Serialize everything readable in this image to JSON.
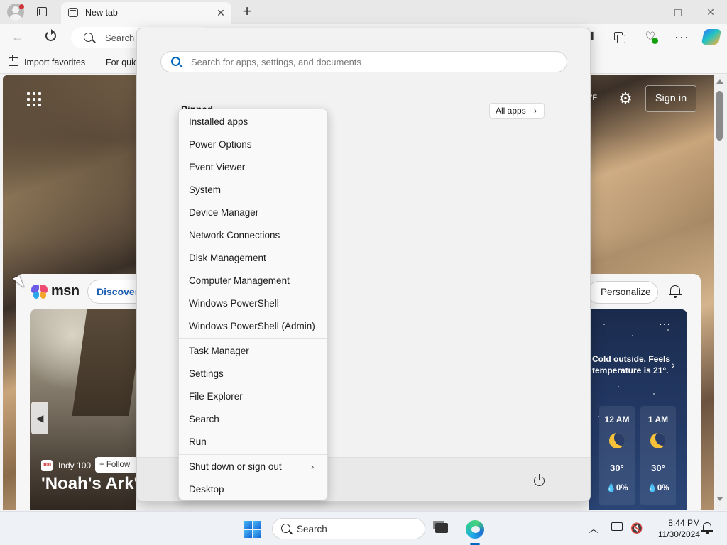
{
  "browser": {
    "tab_title": "New tab",
    "tab_close_glyph": "✕",
    "new_tab_glyph": "+",
    "back_glyph": "←",
    "address_placeholder": "Search",
    "favorites": {
      "import_label": "Import favorites",
      "quick_label": "For quic"
    },
    "more_glyph": "···",
    "icons": [
      "profile-icon",
      "tab-actions-icon",
      "refresh-icon",
      "split-screen-icon",
      "collections-icon",
      "browser-essentials-icon",
      "copilot-icon"
    ]
  },
  "msn": {
    "temp_unit": "°F",
    "gear_glyph": "⚙",
    "signin_label": "Sign in",
    "logo_text": "msn",
    "discover_label": "Discover",
    "personalize_label": "Personalize",
    "news": {
      "source_badge": "100",
      "source": "Indy 100",
      "follow_label": "+ Follow",
      "title": "'Noah's Ark'",
      "prev_glyph": "◀"
    },
    "weather": {
      "message": "Cold outside. Feels temperature is 21°.",
      "chevron_glyph": "›",
      "more_glyph": "···",
      "hours": [
        {
          "time": "12 AM",
          "temp": "30°",
          "precip": "💧0%"
        },
        {
          "time": "1 AM",
          "temp": "30°",
          "precip": "💧0%"
        }
      ]
    }
  },
  "start_menu": {
    "search_placeholder": "Search for apps, settings, and documents",
    "pinned_label": "Pinned",
    "all_apps_label": "All apps",
    "all_apps_chevron": "›"
  },
  "context_menu": {
    "items": [
      "Installed apps",
      "Power Options",
      "Event Viewer",
      "System",
      "Device Manager",
      "Network Connections",
      "Disk Management",
      "Computer Management",
      "Windows PowerShell",
      "Windows PowerShell (Admin)",
      "Task Manager",
      "Settings",
      "File Explorer",
      "Search",
      "Run",
      "Shut down or sign out",
      "Desktop"
    ],
    "submenu_arrow": "›"
  },
  "taskbar": {
    "search_placeholder": "Search",
    "tray_chevron": "︿",
    "volume_glyph": "🔇",
    "time": "8:44 PM",
    "date": "11/30/2024"
  },
  "colors": {
    "accent": "#0067c0",
    "edge_blue": "#1ea9e8",
    "msn_discover": "#1f5fb4",
    "notification_red": "#d13438"
  }
}
